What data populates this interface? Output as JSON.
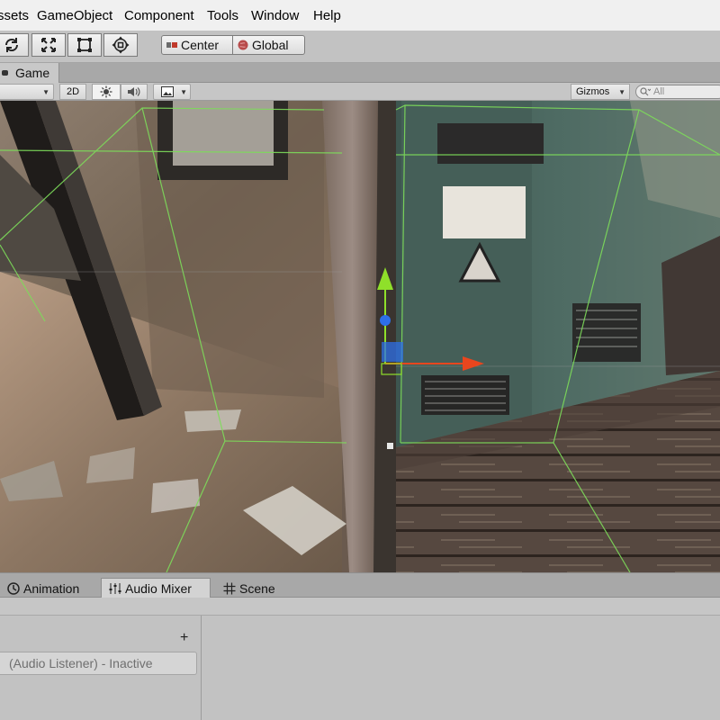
{
  "menu": {
    "items": [
      "ssets",
      "GameObject",
      "Component",
      "Tools",
      "Window",
      "Help"
    ]
  },
  "toolbar": {
    "tools": [
      "rotate-tool-icon",
      "scale-tool-icon",
      "rect-tool-icon",
      "transform-tool-icon"
    ],
    "pivot_label": "Center",
    "space_label": "Global"
  },
  "game_tab": {
    "label": "Game"
  },
  "game_controls": {
    "mode_2d": "2D",
    "gizmos_label": "Gizmos",
    "search_placeholder": "All"
  },
  "bottom_tabs": {
    "animation": "Animation",
    "audio_mixer": "Audio Mixer",
    "scene": "Scene",
    "active_tab": "Audio Mixer"
  },
  "audio_mixer": {
    "add_label": "+",
    "listener_status": "(Audio Listener) - Inactive"
  },
  "colors": {
    "gizmo_wire": "#7ddc5a",
    "axis_y": "#8fe02a",
    "axis_x": "#e8461e",
    "axis_z": "#2d6fe8",
    "panel_bg": "#c2c2c2"
  }
}
